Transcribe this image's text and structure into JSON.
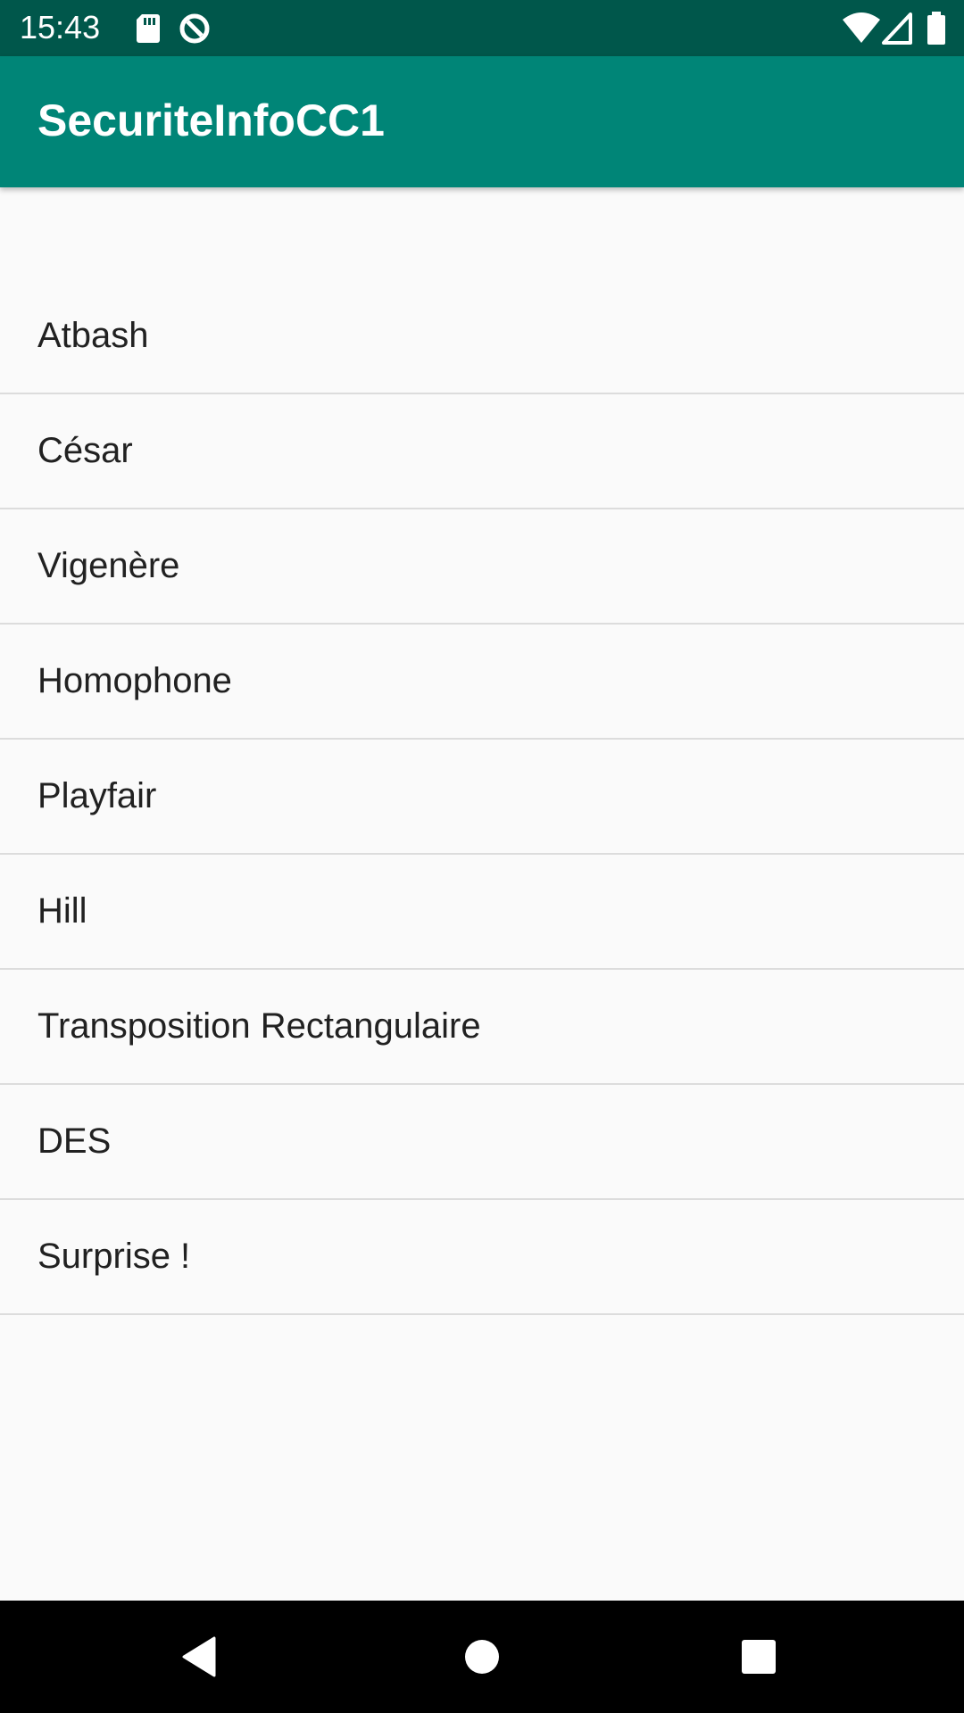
{
  "status_bar": {
    "time": "15:43",
    "left_icons": [
      "sd-card-icon",
      "data-saver-icon"
    ],
    "right_icons": [
      "wifi-icon",
      "signal-icon",
      "battery-icon"
    ],
    "background": "#00574b"
  },
  "app_bar": {
    "title": "SecuriteInfoCC1",
    "background": "#008577"
  },
  "list": {
    "items": [
      {
        "label": "Atbash"
      },
      {
        "label": "César"
      },
      {
        "label": "Vigenère"
      },
      {
        "label": "Homophone"
      },
      {
        "label": "Playfair"
      },
      {
        "label": "Hill"
      },
      {
        "label": "Transposition Rectangulaire"
      },
      {
        "label": "DES"
      },
      {
        "label": "Surprise !"
      }
    ]
  },
  "nav_bar": {
    "buttons": [
      "back-icon",
      "home-icon",
      "recents-icon"
    ],
    "background": "#000000"
  }
}
